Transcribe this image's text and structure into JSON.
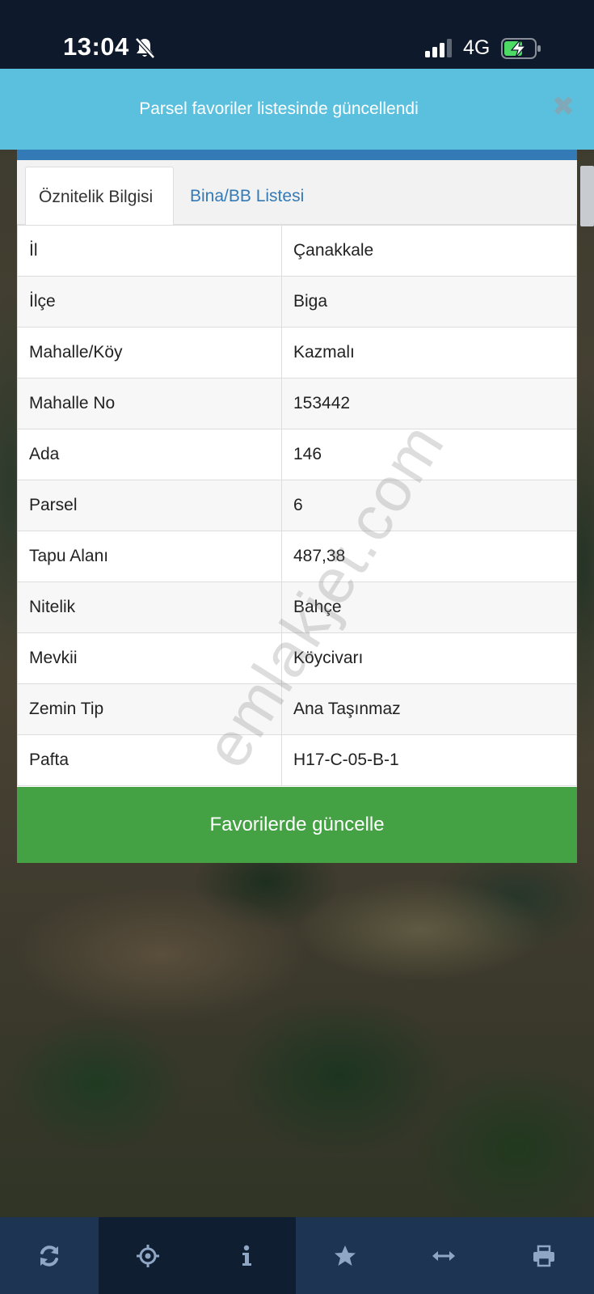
{
  "status_bar": {
    "time": "13:04",
    "network": "4G"
  },
  "notification": {
    "message": "Parsel favoriler listesinde güncellendi",
    "close_symbol": "✖"
  },
  "tabs": [
    {
      "label": "Öznitelik Bilgisi",
      "active": true
    },
    {
      "label": "Bina/BB Listesi",
      "active": false
    }
  ],
  "attributes": [
    {
      "key": "İl",
      "value": "Çanakkale"
    },
    {
      "key": "İlçe",
      "value": "Biga"
    },
    {
      "key": "Mahalle/Köy",
      "value": "Kazmalı"
    },
    {
      "key": "Mahalle No",
      "value": "153442"
    },
    {
      "key": "Ada",
      "value": "146"
    },
    {
      "key": "Parsel",
      "value": "6"
    },
    {
      "key": "Tapu Alanı",
      "value": "487,38"
    },
    {
      "key": "Nitelik",
      "value": "Bahçe"
    },
    {
      "key": "Mevkii",
      "value": "Köycivarı"
    },
    {
      "key": "Zemin Tip",
      "value": "Ana Taşınmaz"
    },
    {
      "key": "Pafta",
      "value": "H17-C-05-B-1"
    }
  ],
  "update_button_label": "Favorilerde güncelle",
  "watermark": "emlakjet.com",
  "toolbar": [
    {
      "icon": "refresh-icon"
    },
    {
      "icon": "crosshair-icon"
    },
    {
      "icon": "info-icon"
    },
    {
      "icon": "star-icon"
    },
    {
      "icon": "horizontal-arrows-icon"
    },
    {
      "icon": "print-icon"
    }
  ],
  "colors": {
    "status_bar": "#0e1a2b",
    "banner": "#5bc0de",
    "panel_accent": "#337ab7",
    "button": "#44a144",
    "toolbar": "#1d3552",
    "toolbar_active": "#0f1e31",
    "battery_green": "#4cd964"
  }
}
